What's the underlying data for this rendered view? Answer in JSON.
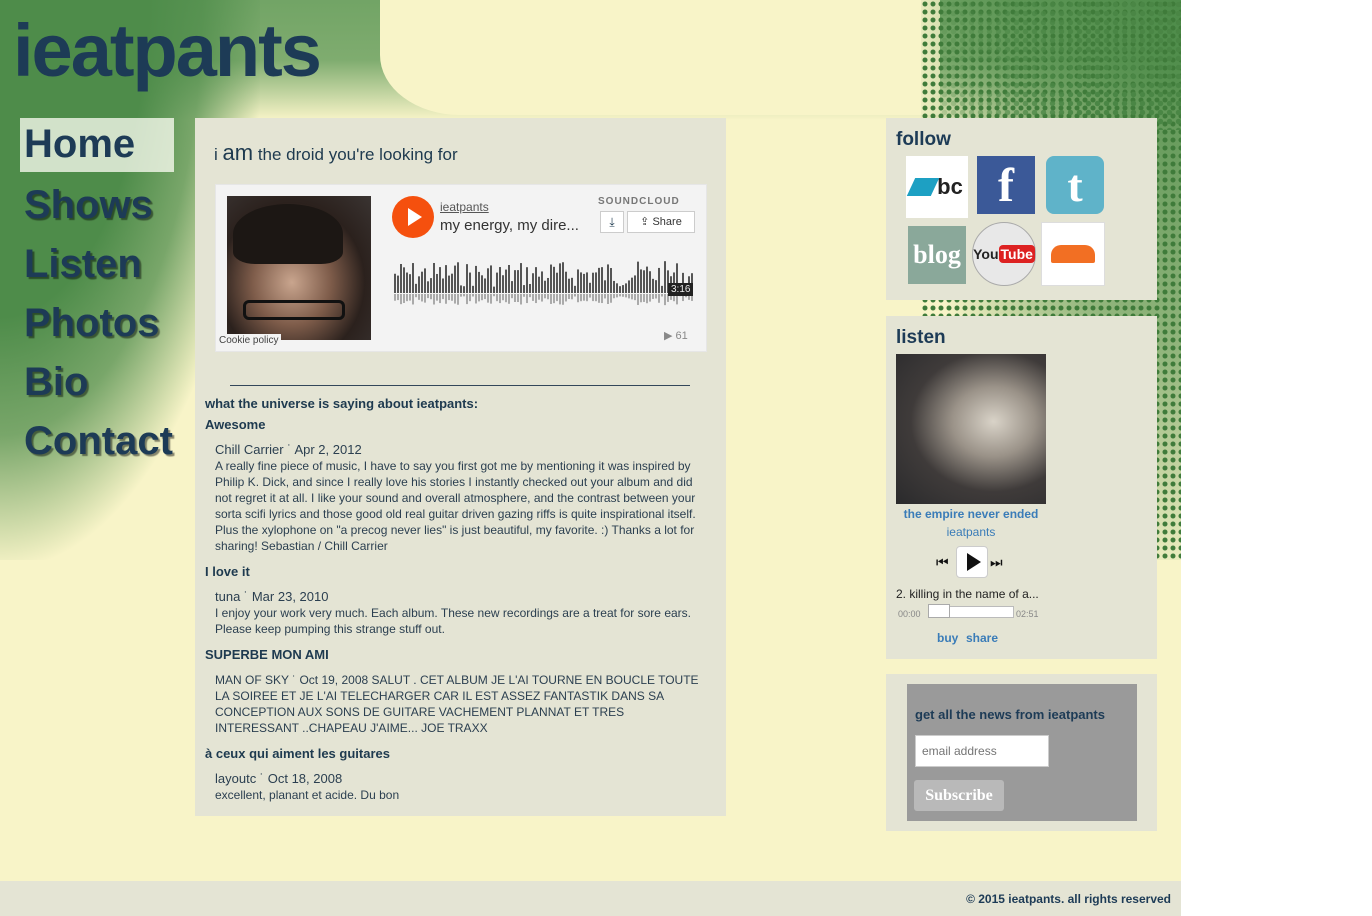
{
  "site": {
    "title": "ieatpants"
  },
  "nav": [
    "Home",
    "Shows",
    "Listen",
    "Photos",
    "Bio",
    "Contact"
  ],
  "main": {
    "tagline_prefix": "i",
    "tagline_big": "am",
    "tagline_rest": "the droid you're looking for",
    "soundcloud": {
      "user": "ieatpants",
      "track": "my energy, my dire...",
      "brand": "SOUNDCLOUD",
      "share_label": "Share",
      "duration": "3:16",
      "plays": "61",
      "cookie": "Cookie policy"
    },
    "reviews_heading": "what the universe is saying about ieatpants:",
    "reviews": [
      {
        "title": "Awesome",
        "meta": "Chill Carrier ˙ Apr 2, 2012",
        "body": "A really fine piece of music, I have to say you first got me by mentioning it was inspired by Philip K. Dick, and since I really love his stories I instantly checked out your album and did not regret it at all. I like your sound and overall atmosphere, and the contrast between your sorta scifi lyrics and those good old real guitar driven gazing riffs is quite inspirational itself. Plus the xylophone on \"a precog never lies\" is just beautiful, my favorite. :) Thanks a lot for sharing! Sebastian / Chill Carrier"
      },
      {
        "title": "I love it",
        "meta": "tuna ˙ Mar 23, 2010",
        "body": "I enjoy your work very much. Each album. These new recordings are a treat for sore ears. Please keep pumping this strange stuff out."
      },
      {
        "title": "SUPERBE MON AMI",
        "meta": "",
        "body": "MAN OF SKY ˙ Oct 19, 2008 SALUT . CET ALBUM JE L'AI TOURNE EN BOUCLE TOUTE LA SOIREE ET JE L'AI TELECHARGER CAR IL EST ASSEZ FANTASTIK DANS SA CONCEPTION AUX SONS DE GUITARE VACHEMENT PLANNAT ET TRES INTERESSANT ..CHAPEAU J'AIME... JOE TRAXX"
      },
      {
        "title": "à ceux qui aiment les guitares",
        "meta": "layoutc ˙ Oct 18, 2008",
        "body": "excellent, planant et acide. Du bon"
      }
    ]
  },
  "follow": {
    "heading": "follow",
    "icons": [
      "bandcamp-icon",
      "facebook-icon",
      "twitter-icon",
      "blog-icon",
      "youtube-icon",
      "soundcloud-icon"
    ],
    "bc_text": "bc",
    "fb_text": "f",
    "tw_text": "t",
    "blog_text": "blog",
    "yt_you": "You",
    "yt_tube": "Tube"
  },
  "listen": {
    "heading": "listen",
    "album_title": "the empire never ended",
    "artist": "ieatpants",
    "track": "2. killing in the name of a...",
    "time_current": "00:00",
    "time_total": "02:51",
    "buy": "buy",
    "share": "share"
  },
  "news": {
    "heading": "get all the news from ieatpants",
    "placeholder": "email address",
    "button": "Subscribe"
  },
  "footer": {
    "copyright": "© 2015 ieatpants. all rights reserved"
  },
  "colors": {
    "background": "#f8f4c8",
    "panel": "#e4e4d4",
    "accent_green": "#4e8c4a",
    "text_dark": "#1d3b56",
    "link": "#3a7cb8",
    "soundcloud_orange": "#f5500e"
  }
}
